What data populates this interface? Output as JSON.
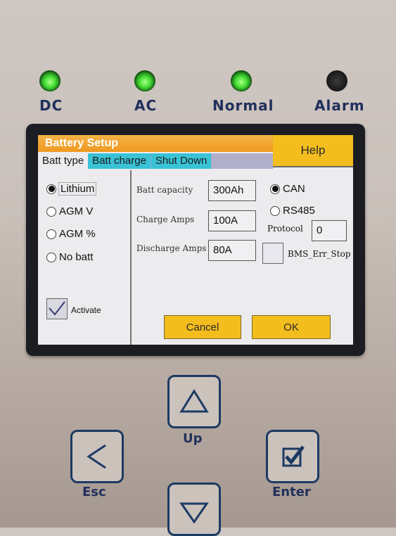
{
  "leds": [
    {
      "label": "DC",
      "state": "on"
    },
    {
      "label": "AC",
      "state": "on"
    },
    {
      "label": "Normal",
      "state": "on"
    },
    {
      "label": "Alarm",
      "state": "off"
    }
  ],
  "dialog": {
    "title": "Battery Setup",
    "help_label": "Help",
    "tabs": [
      "Batt type",
      "Batt charge",
      "Shut Down"
    ],
    "battery_types": [
      "Lithium",
      "AGM V",
      "AGM %",
      "No batt"
    ],
    "selected_battery_type": "Lithium",
    "activate_label": "Activate",
    "activate_checked": true,
    "fields": {
      "batt_capacity_label": "Batt capacity",
      "batt_capacity_value": "300Ah",
      "charge_amps_label": "Charge Amps",
      "charge_amps_value": "100A",
      "discharge_amps_label": "Discharge Amps",
      "discharge_amps_value": "80A"
    },
    "comm": {
      "can_label": "CAN",
      "rs485_label": "RS485",
      "selected": "CAN",
      "protocol_label": "Protocol",
      "protocol_value": "0",
      "bms_err_stop_label": "BMS_Err_Stop",
      "bms_err_stop_checked": false
    },
    "cancel_label": "Cancel",
    "ok_label": "OK"
  },
  "keys": {
    "up_label": "Up",
    "esc_label": "Esc",
    "enter_label": "Enter"
  },
  "colors": {
    "panel_text": "#21305c",
    "title_bar": "#ee9920",
    "button_yellow": "#f4bd1e",
    "tab_cyan": "#3ac2d6",
    "led_green": "#44dd33"
  }
}
